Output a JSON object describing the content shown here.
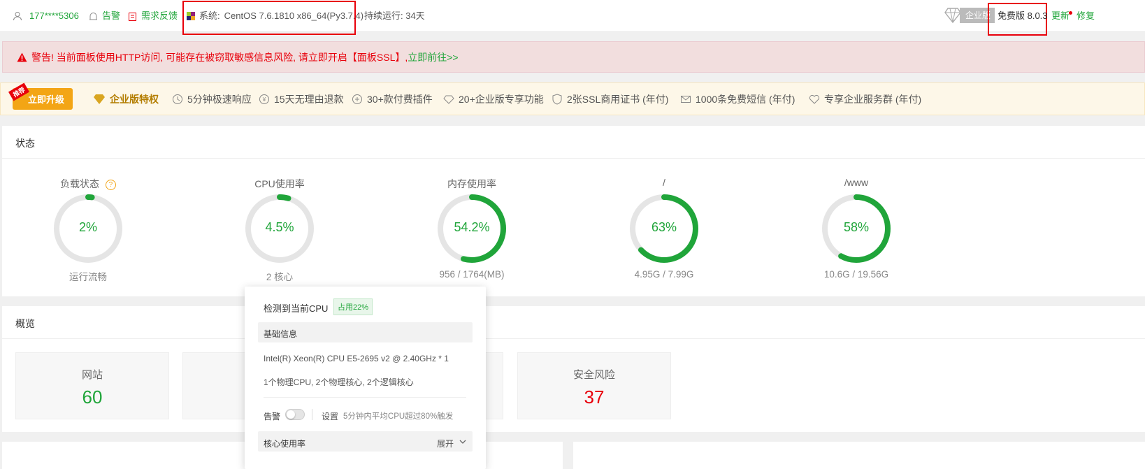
{
  "topbar": {
    "phone": "177****5306",
    "alarm": "告警",
    "feedback": "需求反馈",
    "system_label": "系统:",
    "system_value": "CentOS 7.6.1810 x86_64(Py3.7.4)",
    "uptime": "持续运行: 34天",
    "enterprise_tag": "企业版",
    "version": "免费版 8.0.3",
    "update": "更新",
    "repair": "修复"
  },
  "alert": {
    "text": "警告! 当前面板使用HTTP访问, 可能存在被窃取敏感信息风险, 请立即开启【面板SSL】, ",
    "link": "立即前往>>"
  },
  "promo": {
    "badge": "推荐",
    "upgrade": "立即升级",
    "title": "企业版特权",
    "features": [
      "5分钟极速响应",
      "15天无理由退款",
      "30+款付费插件",
      "20+企业版专享功能",
      "2张SSL商用证书 (年付)",
      "1000条免费短信 (年付)",
      "专享企业服务群 (年付)"
    ]
  },
  "status": {
    "title": "状态",
    "gauges": [
      {
        "label": "负载状态",
        "value": "2%",
        "sub": "运行流畅",
        "pct": 2
      },
      {
        "label": "CPU使用率",
        "value": "4.5%",
        "sub": "2 核心",
        "pct": 4.5
      },
      {
        "label": "内存使用率",
        "value": "54.2%",
        "sub": "956 / 1764(MB)",
        "pct": 54.2
      },
      {
        "label": "/",
        "value": "63%",
        "sub": "4.95G / 7.99G",
        "pct": 63
      },
      {
        "label": "/www",
        "value": "58%",
        "sub": "10.6G / 19.56G",
        "pct": 58
      }
    ]
  },
  "overview": {
    "title": "概览",
    "cards": [
      {
        "label": "网站",
        "value": "60"
      },
      {
        "label": "安全风险",
        "value": "37"
      }
    ]
  },
  "popup": {
    "title": "检测到当前CPU",
    "usage_tag": "占用22%",
    "basic_header": "基础信息",
    "cpu_model": "Intel(R) Xeon(R) CPU E5-2695 v2 @ 2.40GHz * 1",
    "cpu_cores": "1个物理CPU, 2个物理核心, 2个逻辑核心",
    "alarm_label": "告警",
    "settings": "设置",
    "alarm_desc": "5分钟内平均CPU超过80%触发",
    "core_usage": "核心使用率",
    "expand": "展开"
  },
  "colors": {
    "green": "#20a53a",
    "red": "#e8000b",
    "gold": "#f3a515"
  }
}
